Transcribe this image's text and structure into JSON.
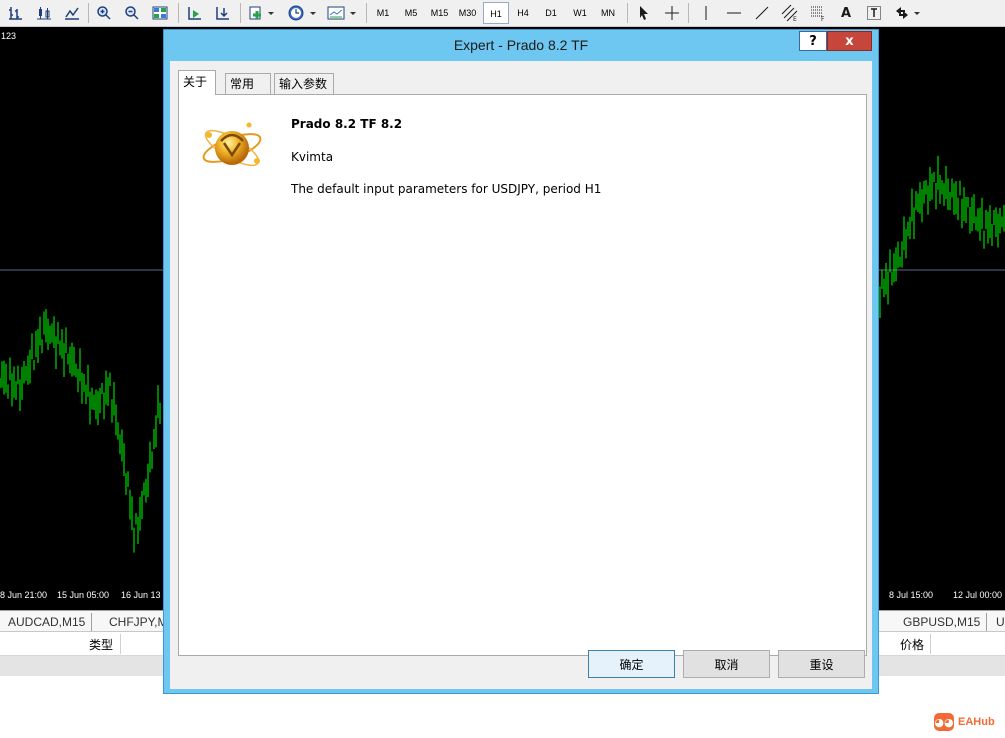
{
  "toolbar": {
    "icons": [
      "bar-chart-icon",
      "candlestick-icon",
      "line-chart-icon",
      "zoom-in-icon",
      "zoom-out-icon",
      "tile-windows-icon",
      "auto-scroll-icon",
      "chart-shift-icon",
      "indicators-icon",
      "periodicity-icon",
      "templates-icon",
      "cursor-icon",
      "crosshair-icon",
      "vertical-line-icon",
      "horizontal-line-icon",
      "trendline-icon",
      "equidistant-channel-icon",
      "fibonacci-icon",
      "text-icon",
      "text-label-icon",
      "arrows-icon"
    ],
    "timeframes": [
      "M1",
      "M5",
      "M15",
      "M30",
      "H1",
      "H4",
      "D1",
      "W1",
      "MN"
    ],
    "selected_timeframe": "H1",
    "text_tool_label": "A"
  },
  "chart": {
    "price_label": "123",
    "time_labels": [
      "8 Jun 21:00",
      "15 Jun 05:00",
      "16 Jun 13",
      "8 Jul 15:00",
      "12 Jul 00:00"
    ],
    "candle_color": "#00ff00",
    "background": "#000000"
  },
  "symbol_tabs": [
    "AUDCAD,M15",
    "CHFJPY,M",
    "GBPUSD,M15",
    "U"
  ],
  "columns": {
    "type_label": "类型",
    "price_label": "价格"
  },
  "dialog": {
    "title": "Expert - Prado 8.2 TF",
    "help_label": "?",
    "close_label": "x",
    "tabs": [
      {
        "label": "关于",
        "active": true
      },
      {
        "label": "常用",
        "active": false
      },
      {
        "label": "输入参数",
        "active": false
      }
    ],
    "about": {
      "name": "Prado 8.2 TF 8.2",
      "author": "Kvimta",
      "description": "The default input parameters for USDJPY, period H1"
    },
    "buttons": {
      "ok": "确定",
      "cancel": "取消",
      "reset": "重设"
    }
  },
  "watermark": {
    "text": "EAHub"
  }
}
